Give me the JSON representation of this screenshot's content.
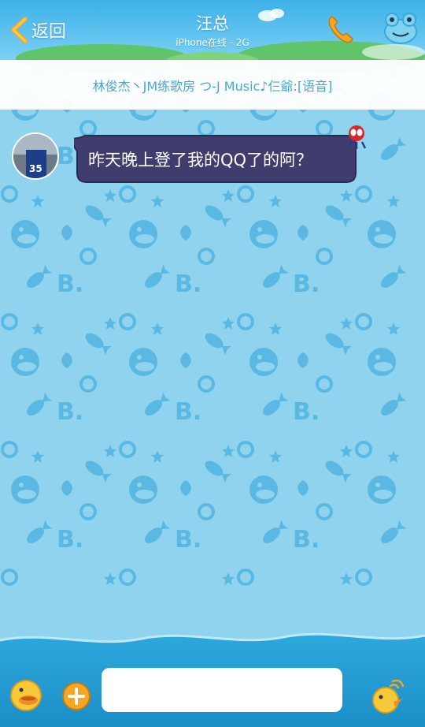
{
  "header": {
    "back_label": "返回",
    "title": "汪总",
    "subtitle": "iPhone在线 - 2G",
    "back_icon": "chevron-left-icon",
    "call_icon": "phone-icon",
    "profile_icon": "frog-mascot-icon"
  },
  "notice": {
    "text": "林俊杰丶JM练歌房 つ-J Music♪仨爺:[语音]"
  },
  "messages": [
    {
      "sender": "other",
      "text": "昨天晚上登了我的QQ了的阿？",
      "avatar_icon": "avatar"
    }
  ],
  "input_bar": {
    "placeholder": "",
    "value": "",
    "left_icon": "duck-emoji-icon",
    "plus_icon": "plus-icon",
    "right_icon": "duck-voice-icon"
  },
  "colors": {
    "background": "#8fd3ef",
    "pattern": "#5fbbe3",
    "bubble": "#3f3d6e",
    "notice_text": "#4aa8cf",
    "accent_orange": "#f6a623"
  }
}
